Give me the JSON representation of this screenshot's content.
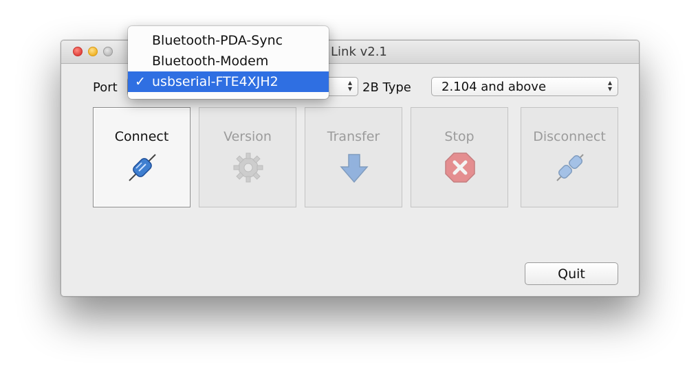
{
  "window": {
    "title_visible": "Link v2.1"
  },
  "port": {
    "label": "Port",
    "menu_items": [
      {
        "label": "Bluetooth-PDA-Sync",
        "checked": false
      },
      {
        "label": "Bluetooth-Modem",
        "checked": false
      },
      {
        "label": "usbserial-FTE4XJH2",
        "checked": true
      }
    ],
    "check_glyph": "✓"
  },
  "type2b": {
    "label": "2B Type",
    "value": "2.104 and above"
  },
  "toolbar": {
    "connect": "Connect",
    "version": "Version",
    "transfer": "Transfer",
    "stop": "Stop",
    "disconnect": "Disconnect"
  },
  "quit_label": "Quit",
  "icons": {
    "connect": "plug-connect-icon",
    "version": "gear-icon",
    "transfer": "down-arrow-icon",
    "stop": "stop-sign-icon",
    "disconnect": "plug-disconnect-icon"
  },
  "colors": {
    "menu_highlight": "#2f6fe2",
    "plug_blue": "#3f7fd0",
    "stop_red": "#e2474a"
  }
}
